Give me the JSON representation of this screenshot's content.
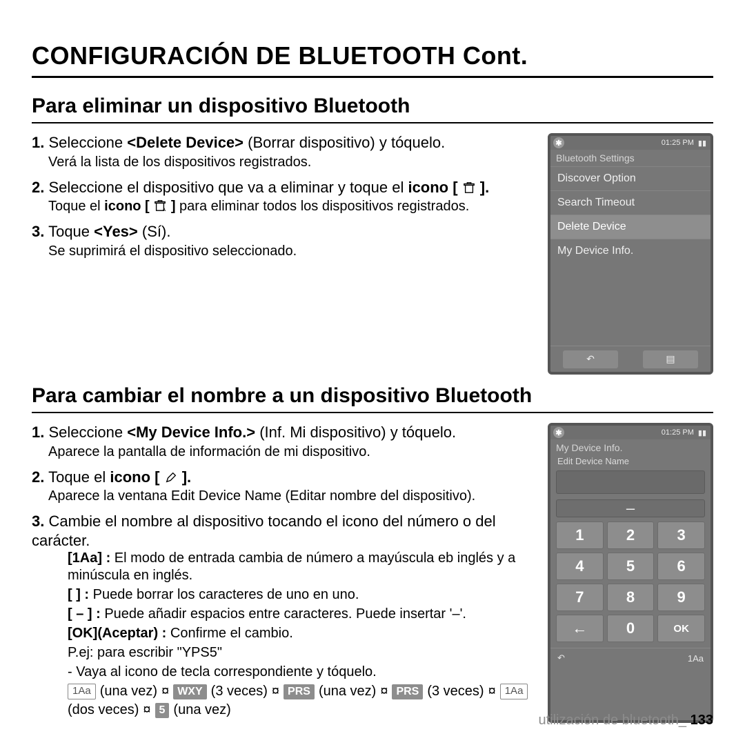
{
  "page_title": "CONFIGURACIÓN DE BLUETOOTH  Cont.",
  "section1": {
    "title": "Para eliminar un dispositivo Bluetooth",
    "step1_pre": "Seleccione ",
    "step1_bold": "<Delete Device>",
    "step1_post": " (Borrar dispositivo) y tóquelo.",
    "step1_sub": "Verá la lista de los dispositivos registrados.",
    "step2_pre": "Seleccione el dispositivo que va a eliminar y toque el ",
    "step2_bold": "icono [ ",
    "step2_post": " ].",
    "step2_sub_pre": "Toque el ",
    "step2_sub_bold": "icono [ ",
    "step2_sub_mid": " ]",
    "step2_sub_post": " para eliminar todos los dispositivos registrados.",
    "step3_pre": "Toque ",
    "step3_bold": "<Yes>",
    "step3_post": " (Sí).",
    "step3_sub": "Se suprimirá el dispositivo seleccionado."
  },
  "device1": {
    "time": "01:25 PM",
    "header": "Bluetooth Settings",
    "items": [
      "Discover Option",
      "Search Timeout",
      "Delete Device",
      "My Device Info."
    ],
    "back": "↶",
    "menu": "▤"
  },
  "section2": {
    "title": "Para cambiar el nombre a un dispositivo Bluetooth",
    "step1_pre": "Seleccione ",
    "step1_bold": "<My Device Info.>",
    "step1_post": " (Inf. Mi dispositivo) y tóquelo.",
    "step1_sub": "Aparece la pantalla de información de mi dispositivo.",
    "step2_pre": "Toque el ",
    "step2_bold": "icono [ ",
    "step2_post": " ].",
    "step2_sub": "Aparece la ventana Edit Device Name (Editar nombre del dispositivo).",
    "step3": "Cambie el nombre al dispositivo tocando el icono del número o del carácter.",
    "defs": {
      "d1_label": "[1Aa] :",
      "d1_text": "El modo de entrada cambia de número a mayúscula eb inglés y a minúscula en inglés.",
      "d2_label": "[     ] :",
      "d2_text": "Puede borrar los caracteres de uno en uno.",
      "d3_label": "[ – ] :",
      "d3_text": "Puede añadir espacios entre caracteres. Puede insertar '–'.",
      "d4_label": "[OK](Aceptar) :",
      "d4_text": "Conﬁrme el cambio.",
      "example_label": "P.ej: para escribir \"YPS5\"",
      "example_instr": "- Vaya al icono de tecla correspondiente y tóquelo."
    }
  },
  "sequence": {
    "s1_chip": "1Aa",
    "s1_txt": "(una vez)",
    "arrow": "¤",
    "s2_chip": "WXY",
    "s2_txt": "(3 veces)",
    "s3_chip": "PRS",
    "s3_txt": "(una vez)",
    "s4_chip": "PRS",
    "s4_txt": "(3 veces)",
    "s5_chip": "1Aa",
    "line2_a": "(dos veces)",
    "s6_chip": "5",
    "s6_txt": "(una vez)"
  },
  "device2": {
    "time": "01:25 PM",
    "header": "My Device Info.",
    "editlabel": "Edit Device Name",
    "dash": "–",
    "keys": [
      "1",
      "2",
      "3",
      "4",
      "5",
      "6",
      "7",
      "8",
      "9",
      "←",
      "0",
      "OK"
    ],
    "back": "↶",
    "mode": "1Aa"
  },
  "footer": {
    "text": "utilización de bluetooth_",
    "page": "133"
  }
}
